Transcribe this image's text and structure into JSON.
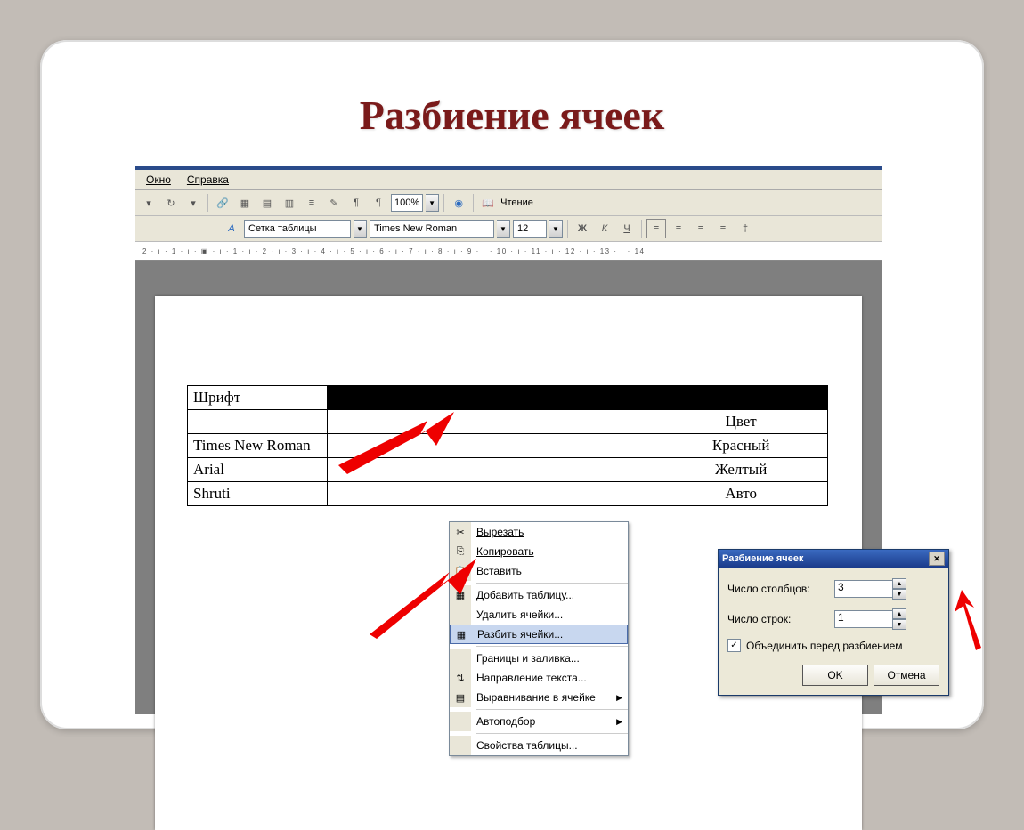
{
  "slide_title": "Разбиение ячеек",
  "menu": {
    "window": "Окно",
    "help": "Справка"
  },
  "toolbar": {
    "zoom": "100%",
    "reading": "Чтение",
    "style_label": "Сетка таблицы",
    "font_name": "Times New Roman",
    "font_size": "12",
    "bold": "Ж",
    "italic": "К",
    "underline": "Ч"
  },
  "ruler_text": "2 · ı · 1 · ı · ▣ · ı · 1 · ı · 2 · ı · 3 · ı · 4 · ı · 5 · ı · 6 · ı · 7 · ı · 8 · ı · 9 · ı · 10 · ı · 11 · ı · 12 · ı · 13 · ı · 14",
  "table": {
    "r0c0": "Шрифт",
    "r1c0": "",
    "r1c2": "Цвет",
    "r2c0": "Times New Roman",
    "r2c2": "Красный",
    "r3c0": "Arial",
    "r3c2": "Желтый",
    "r4c0": "Shruti",
    "r4c2": "Авто"
  },
  "ctx": {
    "cut": "Вырезать",
    "copy": "Копировать",
    "paste": "Вставить",
    "add_table": "Добавить таблицу...",
    "del_cells": "Удалить ячейки...",
    "split_cells": "Разбить ячейки...",
    "borders": "Границы и заливка...",
    "direction": "Направление текста...",
    "align": "Выравнивание в ячейке",
    "autofit": "Автоподбор",
    "props": "Свойства таблицы..."
  },
  "dlg": {
    "title": "Разбиение ячеек",
    "cols_label": "Число столбцов:",
    "cols_value": "3",
    "rows_label": "Число строк:",
    "rows_value": "1",
    "merge_label": "Объединить перед разбиением",
    "ok": "OK",
    "cancel": "Отмена"
  }
}
